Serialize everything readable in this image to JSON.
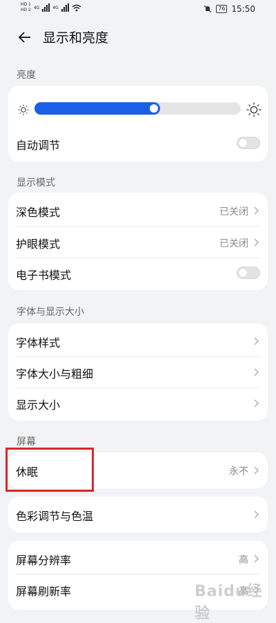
{
  "status_bar": {
    "sim1": "HD 1",
    "sim2": "HD 2",
    "net1": "4G",
    "net2": "4G",
    "battery": "76",
    "time": "15:50"
  },
  "header": {
    "title": "显示和亮度"
  },
  "brightness": {
    "section": "亮度",
    "level": 0.61,
    "auto_label": "自动调节",
    "auto_on": false
  },
  "display_mode": {
    "section": "显示模式",
    "dark_label": "深色模式",
    "dark_value": "已关闭",
    "eye_label": "护眼模式",
    "eye_value": "已关闭",
    "ebook_label": "电子书模式",
    "ebook_on": false
  },
  "font": {
    "section": "字体与显示大小",
    "style_label": "字体样式",
    "size_label": "字体大小与粗细",
    "display_size_label": "显示大小"
  },
  "screen": {
    "section": "屏幕",
    "sleep_label": "休眠",
    "sleep_value": "永不",
    "color_label": "色彩调节与色温",
    "resolution_label": "屏幕分辨率",
    "resolution_value": "高",
    "refresh_label": "屏幕刷新率",
    "refresh_value": "高"
  },
  "watermark": "Baidu经验",
  "colors": {
    "accent": "#1b5fe6",
    "highlight": "#d9262a"
  }
}
